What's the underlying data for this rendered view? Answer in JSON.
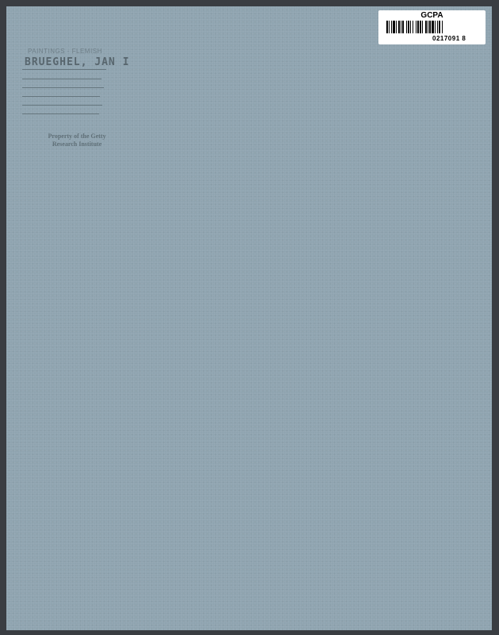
{
  "card": {
    "category_stamp": "PAINTINGS - FLEMISH",
    "artist_stamp": "BRUEGHEL, JAN I",
    "property_stamp_line1": "Property of the Getty",
    "property_stamp_line2": "Research Institute"
  },
  "barcode_label": {
    "code": "GCPA",
    "number": "0217091  8"
  }
}
